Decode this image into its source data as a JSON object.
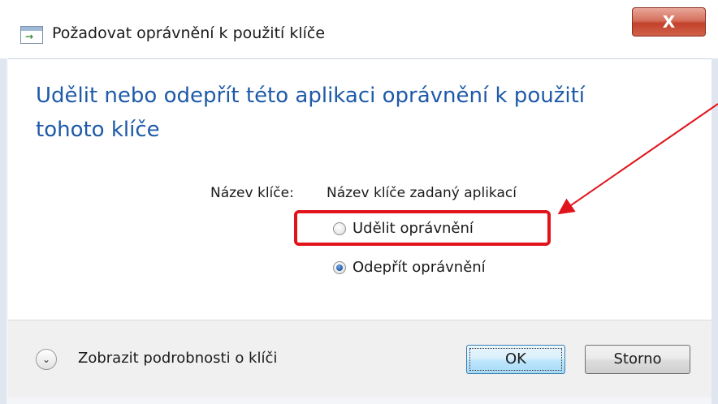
{
  "window": {
    "title": "Požadovat oprávnění k použití klíče",
    "close_label": "X",
    "icon": "window-app-icon"
  },
  "main": {
    "heading": "Udělit nebo odepřít této aplikaci oprávnění k použití tohoto klíče",
    "key_label": "Název klíče:",
    "key_value": "Název klíče zadaný aplikací",
    "options": [
      {
        "label": "Udělit oprávnění",
        "checked": false
      },
      {
        "label": "Odepřít oprávnění",
        "checked": true
      }
    ]
  },
  "footer": {
    "details_label": "Zobrazit podrobnosti o klíči",
    "ok_label": "OK",
    "cancel_label": "Storno"
  },
  "colors": {
    "heading": "#1e5aa8",
    "annotation": "#e0141b"
  }
}
